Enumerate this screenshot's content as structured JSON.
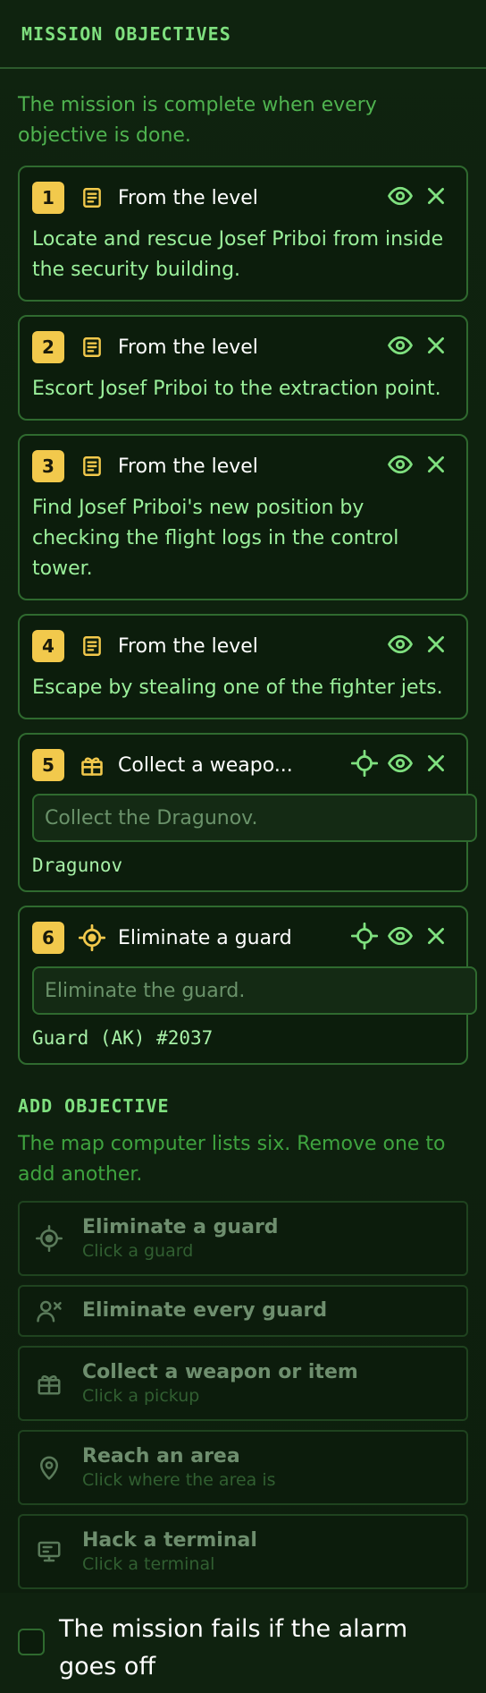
{
  "header": {
    "title": "MISSION OBJECTIVES"
  },
  "intro": "The mission is complete when every objective is done.",
  "objectives": [
    {
      "num": "1",
      "icon": "document-icon",
      "title": "From the level",
      "description": "Locate and rescue Josef Priboi from inside the security building."
    },
    {
      "num": "2",
      "icon": "document-icon",
      "title": "From the level",
      "description": "Escort Josef Priboi to the extraction point."
    },
    {
      "num": "3",
      "icon": "document-icon",
      "title": "From the level",
      "description": "Find Josef Priboi's new position by checking the flight logs in the control tower."
    },
    {
      "num": "4",
      "icon": "document-icon",
      "title": "From the level",
      "description": "Escape by stealing one of the fighter jets."
    },
    {
      "num": "5",
      "icon": "gift-icon",
      "title": "Collect a weapo...",
      "input_value": "",
      "input_placeholder": "Collect the Dragunov.",
      "target": "Dragunov"
    },
    {
      "num": "6",
      "icon": "target-icon",
      "title": "Eliminate a guard",
      "input_value": "",
      "input_placeholder": "Eliminate the guard.",
      "target": "Guard (AK) #2037"
    }
  ],
  "add_section": {
    "title": "ADD OBJECTIVE",
    "help": "The map computer lists six. Remove one to add another.",
    "items": [
      {
        "icon": "target-icon",
        "label": "Eliminate a guard",
        "hint": "Click a guard"
      },
      {
        "icon": "person-remove-icon",
        "label": "Eliminate every guard",
        "hint": ""
      },
      {
        "icon": "gift-icon",
        "label": "Collect a weapon or item",
        "hint": "Click a pickup"
      },
      {
        "icon": "map-pin-icon",
        "label": "Reach an area",
        "hint": "Click where the area is"
      },
      {
        "icon": "terminal-icon",
        "label": "Hack a terminal",
        "hint": "Click a terminal"
      }
    ]
  },
  "footer": {
    "alarm_label": "The mission fails if the alarm goes off",
    "alarm_checked": false
  },
  "colors": {
    "accent_yellow": "#f2c94c",
    "accent_green": "#7fe07f",
    "background": "#0e200e"
  }
}
